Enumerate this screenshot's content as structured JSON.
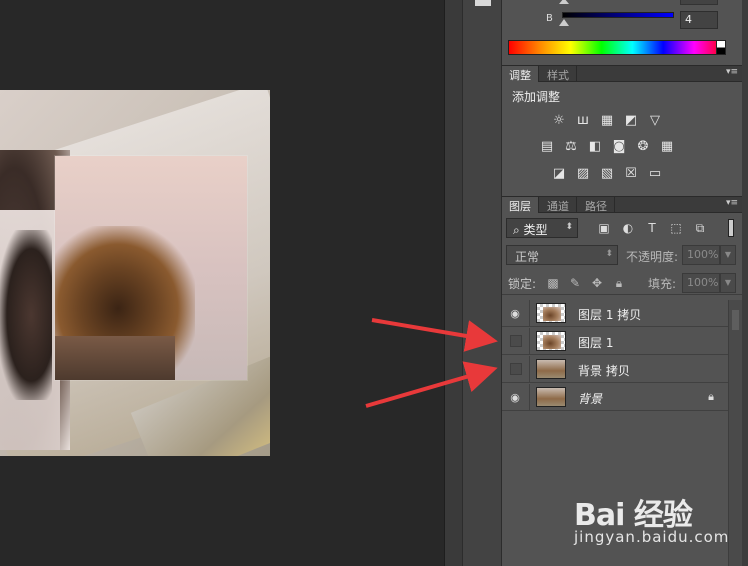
{
  "color_panel": {
    "channel_b_label": "B",
    "channel_b_value": "4"
  },
  "adjust_panel": {
    "tabs": [
      "调整",
      "样式"
    ],
    "title": "添加调整",
    "icons_row1": [
      "brightness-contrast-icon",
      "levels-icon",
      "curves-icon",
      "exposure-icon",
      "vibrance-icon"
    ],
    "icons_row2": [
      "hue-saturation-icon",
      "color-balance-icon",
      "black-white-icon",
      "photo-filter-icon",
      "channel-mixer-icon",
      "color-lookup-icon"
    ],
    "icons_row3": [
      "invert-icon",
      "posterize-icon",
      "threshold-icon",
      "selective-color-icon",
      "gradient-map-icon"
    ]
  },
  "layers_panel": {
    "tabs": [
      "图层",
      "通道",
      "路径"
    ],
    "filter_label": "类型",
    "blend_mode": "正常",
    "opacity_label": "不透明度:",
    "opacity_value": "100%",
    "lock_label": "锁定:",
    "fill_label": "填充:",
    "fill_value": "100%",
    "layers": [
      {
        "name": "图层 1 拷贝",
        "visible": true
      },
      {
        "name": "图层 1",
        "visible": false
      },
      {
        "name": "背景 拷贝",
        "visible": false
      },
      {
        "name": "背景",
        "visible": true,
        "locked": true
      }
    ]
  },
  "watermark": {
    "logo": "Bai 经验",
    "url": "jingyan.baidu.com"
  },
  "colors": {
    "arrow": "#e8393a",
    "panel_bg": "#535353",
    "canvas_bg": "#282828"
  }
}
